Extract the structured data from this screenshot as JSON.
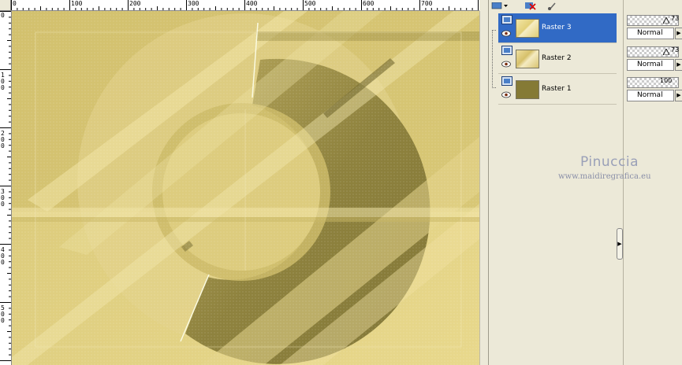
{
  "ruler_top": {
    "labels": [
      "0",
      "100",
      "200",
      "300",
      "400",
      "500",
      "600",
      "700"
    ]
  },
  "ruler_left": {
    "labels": [
      "0",
      "1\n0\n0",
      "2\n0\n0",
      "3\n0\n0",
      "4\n0\n0",
      "5\n0\n0"
    ]
  },
  "layers": [
    {
      "name": "Raster 3",
      "selected": true,
      "opacity": "73",
      "blend": "Normal"
    },
    {
      "name": "Raster 2",
      "selected": false,
      "opacity": "73",
      "blend": "Normal"
    },
    {
      "name": "Raster 1",
      "selected": false,
      "opacity": "100",
      "blend": "Normal"
    }
  ],
  "watermark": {
    "name": "Pinuccia",
    "url": "www.maidiregrafica.eu"
  },
  "colors": {
    "canvas_light": "#e4d486",
    "canvas_dark": "#8a7e3a",
    "selection": "#316ac5",
    "panel_bg": "#ece9d8"
  },
  "icons": [
    "layer-icon",
    "delete-layer-icon",
    "brush-icon",
    "eye-icon",
    "chevron-down-icon",
    "chevron-right-icon"
  ]
}
